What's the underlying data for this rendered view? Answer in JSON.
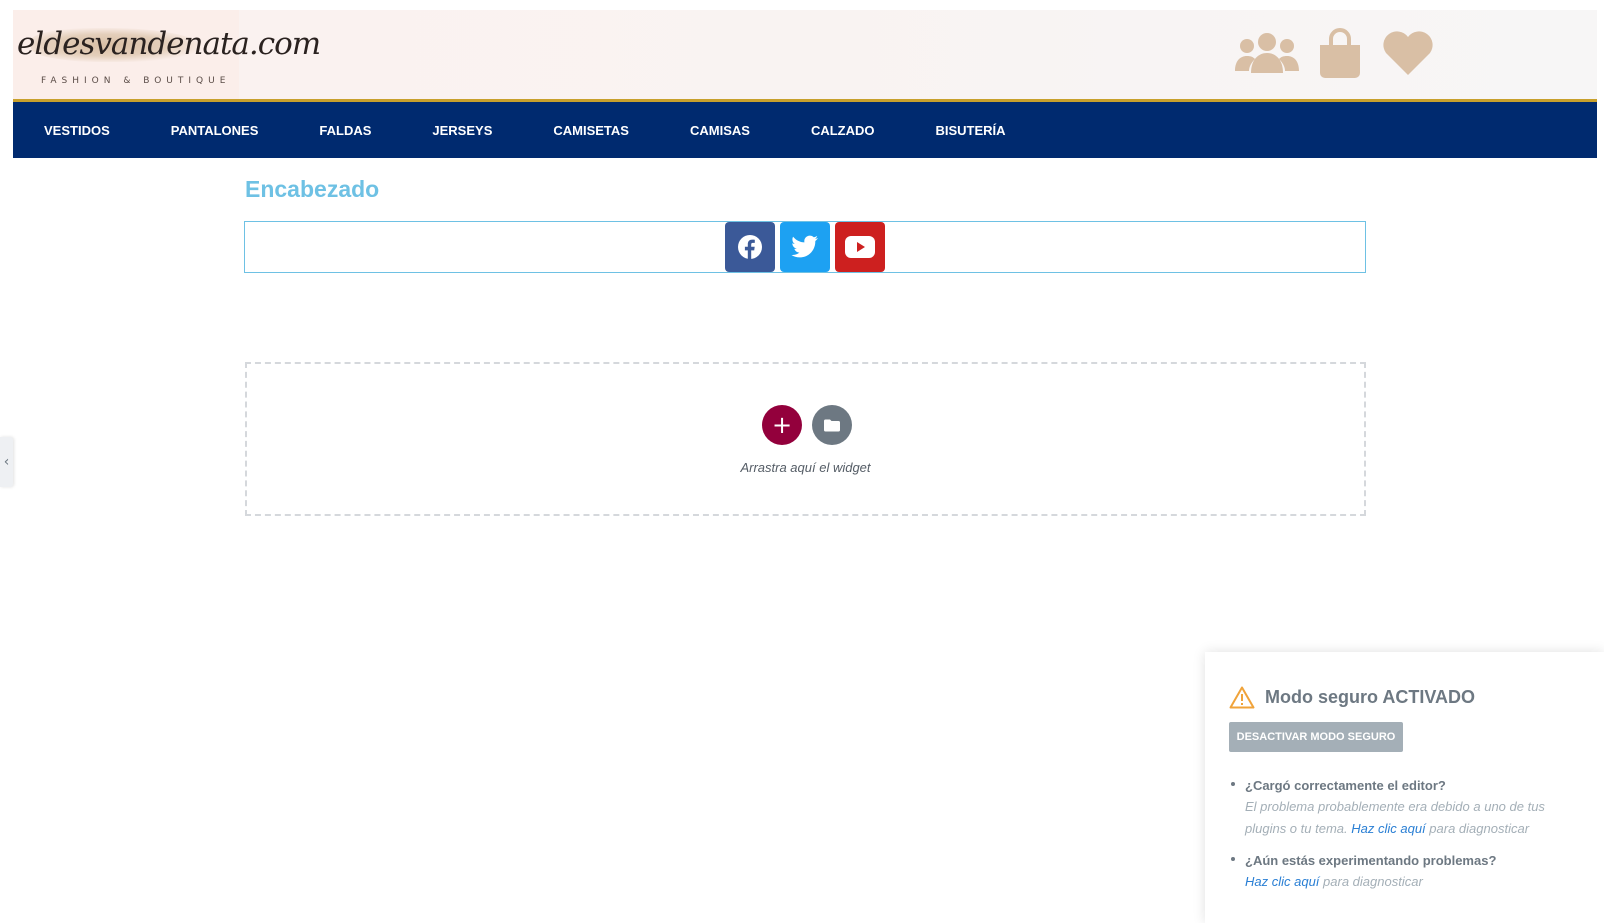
{
  "header": {
    "logo_script": "eldesvandenata.com",
    "logo_tagline": "FASHION & BOUTIQUE",
    "icons": [
      "users-icon",
      "shopping-bag-icon",
      "heart-icon"
    ]
  },
  "nav": {
    "items": [
      {
        "label": "VESTIDOS"
      },
      {
        "label": "PANTALONES"
      },
      {
        "label": "FALDAS"
      },
      {
        "label": "JERSEYS"
      },
      {
        "label": "CAMISETAS"
      },
      {
        "label": "CAMISAS"
      },
      {
        "label": "CALZADO"
      },
      {
        "label": "BISUTERÍA"
      }
    ]
  },
  "content": {
    "heading": "Encabezado",
    "social": [
      "facebook-icon",
      "twitter-icon",
      "youtube-icon"
    ],
    "dropzone_text": "Arrastra aquí el widget",
    "add_symbol": "+"
  },
  "side_handle": {
    "symbol": "‹"
  },
  "safe_mode": {
    "title": "Modo seguro ACTIVADO",
    "button": "DESACTIVAR MODO SEGURO",
    "q1": "¿Cargó correctamente el editor?",
    "a1_text": "El problema probablemente era debido a uno de tus plugins o tu tema.",
    "a1_link": "Haz clic aquí",
    "a1_suffix": "para diagnosticar",
    "q2": "¿Aún estás experimentando problemas?",
    "a2_link": "Haz clic aquí",
    "a2_suffix": "para diagnosticar"
  },
  "colors": {
    "nav_bg": "#002a6f",
    "gold": "#c8a02c",
    "icon_tan": "#d9bfa5",
    "heading_blue": "#6ec1e4",
    "add_button": "#93003c"
  }
}
